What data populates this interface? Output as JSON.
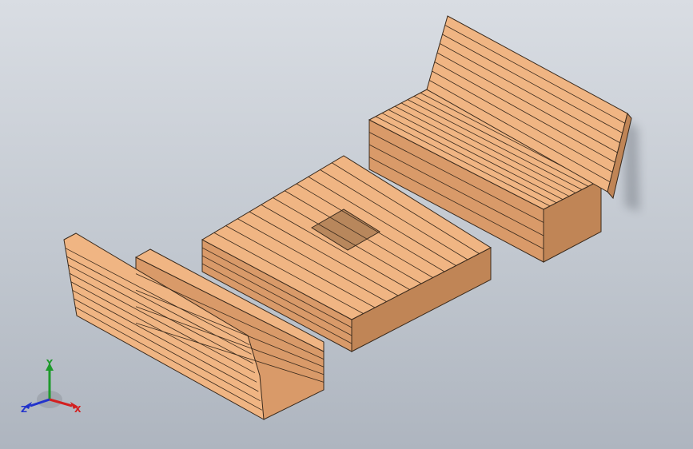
{
  "triad": {
    "x_label": "X",
    "y_label": "Y",
    "z_label": "Z"
  },
  "colors": {
    "viewport_top": "#d9dde3",
    "viewport_bottom": "#aeb5bf",
    "wood_top": "#f0b583",
    "wood_side": "#d99a69",
    "wood_dark": "#c08556",
    "edge": "#3a2a1c",
    "axis_x": "#d32020",
    "axis_y": "#1e9a2c",
    "axis_z": "#2233cc"
  }
}
